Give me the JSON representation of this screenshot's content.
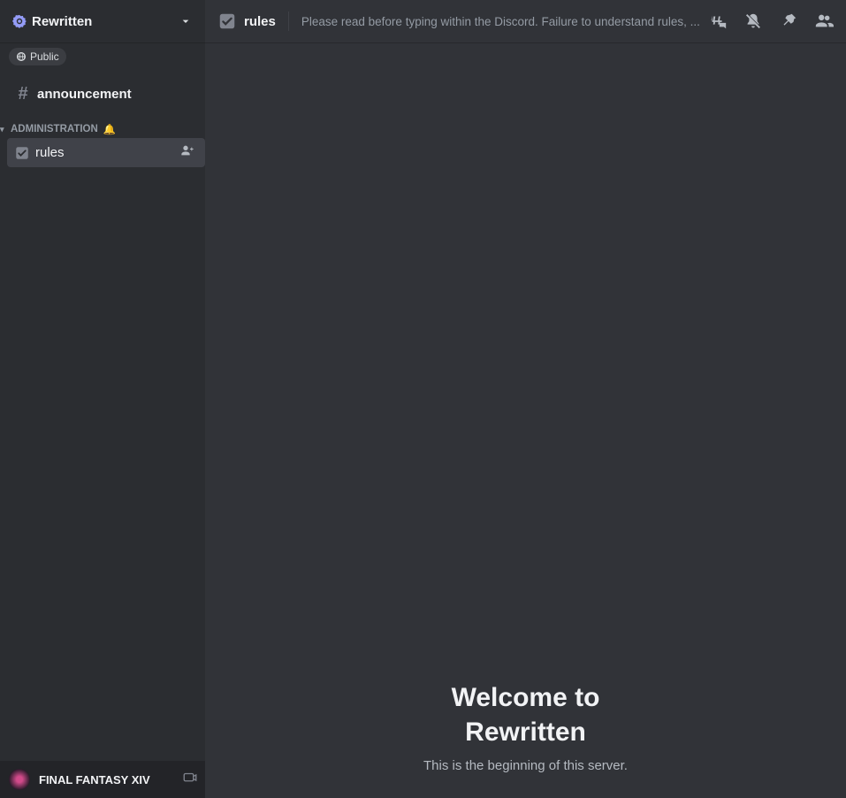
{
  "sidebar": {
    "server_name": "Rewritten",
    "public_badge": "Public",
    "channels": {
      "announcement": "announcement",
      "rules": "rules"
    },
    "categories": {
      "administration": "ADMINISTRATION"
    },
    "footer": {
      "game_name": "FINAL FANTASY XIV"
    }
  },
  "topbar": {
    "channel_name": "rules",
    "description": "Please read before typing within the Discord. Failure to understand rules, ..."
  },
  "content": {
    "welcome_line1": "Welcome to",
    "welcome_line2": "Rewritten",
    "subtitle": "This is the beginning of this server."
  }
}
